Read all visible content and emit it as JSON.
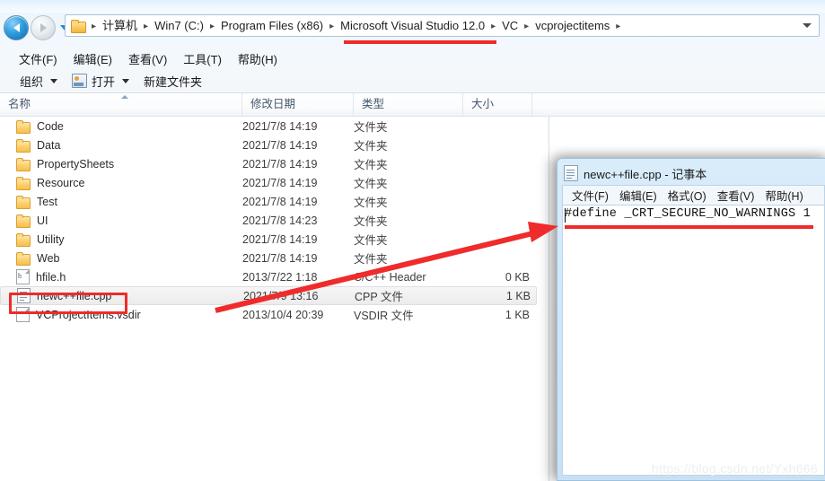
{
  "explorer": {
    "nav": {
      "back_label": "Back",
      "forward_label": "Forward",
      "recent_label": "Recent pages"
    },
    "address_bar": {
      "folder_icon": "folder-icon",
      "breadcrumbs": [
        {
          "label": "计算机",
          "highlighted": false
        },
        {
          "label": "Win7 (C:)",
          "highlighted": false
        },
        {
          "label": "Program Files (x86)",
          "highlighted": false
        },
        {
          "label": "Microsoft Visual Studio 12.0",
          "highlighted": true
        },
        {
          "label": "VC",
          "highlighted": false
        },
        {
          "label": "vcprojectitems",
          "highlighted": false
        }
      ],
      "separator": "▸",
      "dropdown_icon": "chevron-down-icon"
    },
    "menubar": [
      {
        "label": "文件(F)"
      },
      {
        "label": "编辑(E)"
      },
      {
        "label": "查看(V)"
      },
      {
        "label": "工具(T)"
      },
      {
        "label": "帮助(H)"
      }
    ],
    "toolbar": {
      "organize_label": "组织",
      "open_label": "打开",
      "open_icon": "open-file-icon",
      "new_folder_label": "新建文件夹"
    },
    "columns": [
      {
        "label": "名称",
        "sorted": true
      },
      {
        "label": "修改日期",
        "sorted": false
      },
      {
        "label": "类型",
        "sorted": false
      },
      {
        "label": "大小",
        "sorted": false
      }
    ],
    "rows": [
      {
        "name": "Code",
        "date": "2021/7/8 14:19",
        "type": "文件夹",
        "size": "",
        "icon": "folder-icon",
        "selected": false
      },
      {
        "name": "Data",
        "date": "2021/7/8 14:19",
        "type": "文件夹",
        "size": "",
        "icon": "folder-icon",
        "selected": false
      },
      {
        "name": "PropertySheets",
        "date": "2021/7/8 14:19",
        "type": "文件夹",
        "size": "",
        "icon": "folder-icon",
        "selected": false
      },
      {
        "name": "Resource",
        "date": "2021/7/8 14:19",
        "type": "文件夹",
        "size": "",
        "icon": "folder-icon",
        "selected": false
      },
      {
        "name": "Test",
        "date": "2021/7/8 14:19",
        "type": "文件夹",
        "size": "",
        "icon": "folder-icon",
        "selected": false
      },
      {
        "name": "UI",
        "date": "2021/7/8 14:23",
        "type": "文件夹",
        "size": "",
        "icon": "folder-icon",
        "selected": false
      },
      {
        "name": "Utility",
        "date": "2021/7/8 14:19",
        "type": "文件夹",
        "size": "",
        "icon": "folder-icon",
        "selected": false
      },
      {
        "name": "Web",
        "date": "2021/7/8 14:19",
        "type": "文件夹",
        "size": "",
        "icon": "folder-icon",
        "selected": false
      },
      {
        "name": "hfile.h",
        "date": "2013/7/22 1:18",
        "type": "C/C++ Header",
        "size": "0 KB",
        "icon": "h-file-icon",
        "selected": false
      },
      {
        "name": "newc++file.cpp",
        "date": "2021/7/9 13:16",
        "type": "CPP 文件",
        "size": "1 KB",
        "icon": "cpp-file-icon",
        "selected": true
      },
      {
        "name": "VCProjectItems.vsdir",
        "date": "2013/10/4 20:39",
        "type": "VSDIR 文件",
        "size": "1 KB",
        "icon": "doc-file-icon",
        "selected": false
      }
    ]
  },
  "notepad": {
    "title": "newc++file.cpp - 记事本",
    "icon": "notepad-icon",
    "menubar": [
      {
        "label": "文件(F)"
      },
      {
        "label": "编辑(E)"
      },
      {
        "label": "格式(O)"
      },
      {
        "label": "查看(V)"
      },
      {
        "label": "帮助(H)"
      }
    ],
    "content": "#define _CRT_SECURE_NO_WARNINGS 1"
  },
  "annotations": {
    "rect_color": "#ef2b2b",
    "arrow_color": "#ef2b2b",
    "crumb_underline_color": "#ef2b2b",
    "text_underline_color": "#ef2b2b"
  },
  "watermark": "https://blog.csdn.net/Yxh666"
}
